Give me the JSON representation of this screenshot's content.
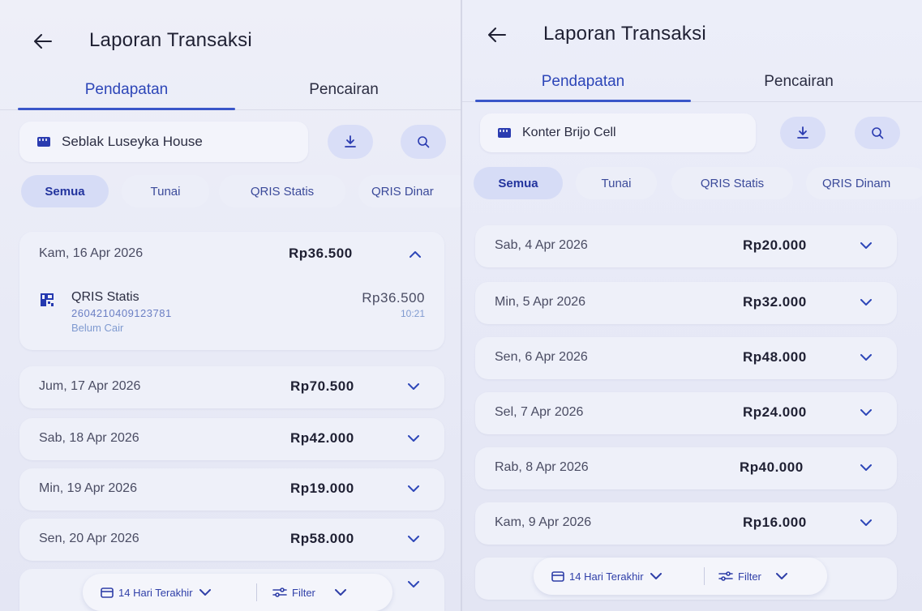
{
  "left": {
    "header": {
      "title": "Laporan Transaksi"
    },
    "tabs": [
      {
        "label": "Pendapatan"
      },
      {
        "label": "Pencairan"
      }
    ],
    "merchant": {
      "name": "Seblak Luseyka House"
    },
    "chips": [
      "Semua",
      "Tunai",
      "QRIS Statis",
      "QRIS Dinar"
    ],
    "days": [
      {
        "date": "Kam, 16 Apr 2026",
        "total": "Rp36.500",
        "expanded": true,
        "transactions": [
          {
            "method": "QRIS Statis",
            "ref": "2604210409123781",
            "status": "Belum Cair",
            "amount": "Rp36.500",
            "time": "10:21"
          }
        ]
      },
      {
        "date": "Jum, 17 Apr 2026",
        "total": "Rp70.500"
      },
      {
        "date": "Sab, 18 Apr 2026",
        "total": "Rp42.000"
      },
      {
        "date": "Min, 19 Apr 2026",
        "total": "Rp19.000"
      },
      {
        "date": "Sen, 20 Apr 2026",
        "total": "Rp58.000"
      }
    ],
    "bottom": {
      "range": "14 Hari Terakhir",
      "filter": "Filter"
    }
  },
  "right": {
    "header": {
      "title": "Laporan Transaksi"
    },
    "tabs": [
      {
        "label": "Pendapatan"
      },
      {
        "label": "Pencairan"
      }
    ],
    "merchant": {
      "name": "Konter Brijo Cell"
    },
    "chips": [
      "Semua",
      "Tunai",
      "QRIS Statis",
      "QRIS Dinam"
    ],
    "days": [
      {
        "date": "Sab, 4 Apr 2026",
        "total": "Rp20.000"
      },
      {
        "date": "Min, 5 Apr 2026",
        "total": "Rp32.000"
      },
      {
        "date": "Sen, 6 Apr 2026",
        "total": "Rp48.000"
      },
      {
        "date": "Sel, 7 Apr 2026",
        "total": "Rp24.000"
      },
      {
        "date": "Rab, 8 Apr 2026",
        "total": "Rp40.000"
      },
      {
        "date": "Kam, 9 Apr 2026",
        "total": "Rp16.000"
      }
    ],
    "bottom": {
      "range": "14 Hari Terakhir",
      "filter": "Filter"
    }
  },
  "colors": {
    "accent": "#2d46b8",
    "chip_active_bg": "#d6dcf6",
    "icon_button_bg": "#d9def7",
    "link_blue": "#6b7fc4"
  },
  "icons": {
    "back": "arrow-left-icon",
    "download": "download-icon",
    "search": "search-icon",
    "store": "store-icon",
    "qris": "qris-icon",
    "calendar": "calendar-icon",
    "filter": "filter-icon",
    "chevron_down": "chevron-down-icon",
    "chevron_up": "chevron-up-icon"
  }
}
